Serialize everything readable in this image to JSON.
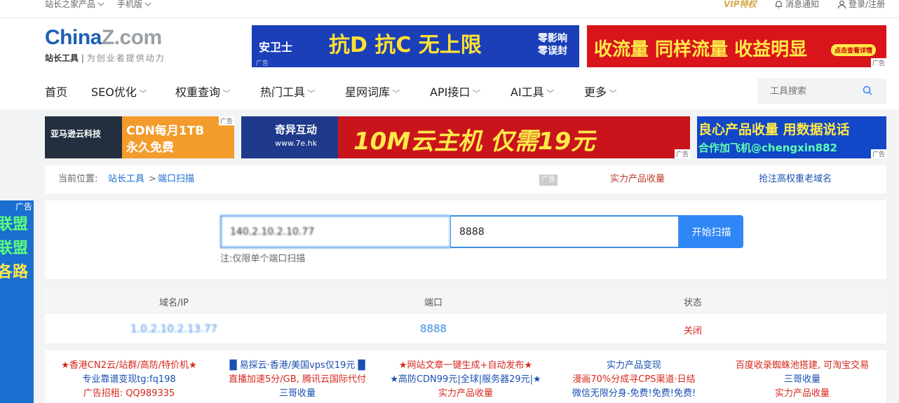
{
  "topbar": {
    "site_products": "站长之家产品",
    "mobile": "手机版",
    "vip": "VIP特权",
    "notifications": "消息通知",
    "login": "登录/注册"
  },
  "logo": {
    "brand_a": "China",
    "brand_b": "Z.com",
    "slogan_a": "站长工具",
    "slogan_b": "为创业者提供动力"
  },
  "ads": {
    "banner1": {
      "brand": "安卫士",
      "headline": "抗D 抗C 无上限",
      "sub1": "零影响",
      "sub2": "零误封",
      "tag": "广告"
    },
    "banner2": {
      "headline": "收流量 同样流量 收益明显",
      "cta": "点击查看详情",
      "tag": "广告"
    },
    "small1": {
      "brand": "亚马逊云科技",
      "line1": "CDN每月1TB",
      "line2": "永久免费",
      "tag": "广告"
    },
    "small2": {
      "brand": "奇异互动",
      "domain": "www.7e.hk",
      "headline": "10M云主机 仅需19元",
      "tag": "广告"
    },
    "small3": {
      "line1": "良心产品收量 用数据说话",
      "line2": "合作加飞机@chengxin882",
      "tag": "广告"
    },
    "side": {
      "tag": "广告",
      "lines": [
        "联盟",
        "联盟",
        "各路"
      ]
    }
  },
  "nav": {
    "items": [
      "首页",
      "SEO优化",
      "权重查询",
      "热门工具",
      "星网词库",
      "API接口",
      "AI工具",
      "更多"
    ],
    "search_placeholder": "工具搜索"
  },
  "breadcrumb": {
    "label": "当前位置:",
    "root": "站长工具",
    "sep": ">",
    "current": "端口扫描",
    "ad_tag": "广告",
    "link1": "实力产品收量",
    "link2": "抢注高权重老域名"
  },
  "scan": {
    "host_value": "140.2.10.2.10.77",
    "port_value": "8888",
    "button": "开始扫描",
    "note": "注:仅限单个端口扫描"
  },
  "results": {
    "headers": [
      "域名/IP",
      "端口",
      "状态"
    ],
    "row": {
      "host": "1.0.2.10.2.13.77",
      "port": "8888",
      "status": "关闭"
    }
  },
  "adlinks": [
    [
      "★香港CN2云/站群/高防/特价机★",
      "专业靠谱变现tg:fq198",
      "广告招租: QQ989335"
    ],
    [
      "█ 易探云·香港/美国vps仅19元 █",
      "直播加速5分/GB, 腾讯云国际代付",
      "三哥收量"
    ],
    [
      "★网站文章一键生成+自动发布★",
      "★高防CDN99元|全球|服务器29元|★",
      "实力产品收量"
    ],
    [
      "实力产品变现",
      "漫画70%分成寻CPS渠道·日结",
      "微信无限分身-免费!免费!免费!"
    ],
    [
      "百度收录蜘蛛池搭建, 可淘宝交易",
      "三哥收量",
      "实力产品收量"
    ]
  ],
  "colors": {
    "accent": "#2f86f6",
    "brand_blue": "#1d5fb4",
    "ad_red": "#d6281e",
    "link_blue": "#1a4fb0",
    "status_closed": "#d6281e"
  }
}
